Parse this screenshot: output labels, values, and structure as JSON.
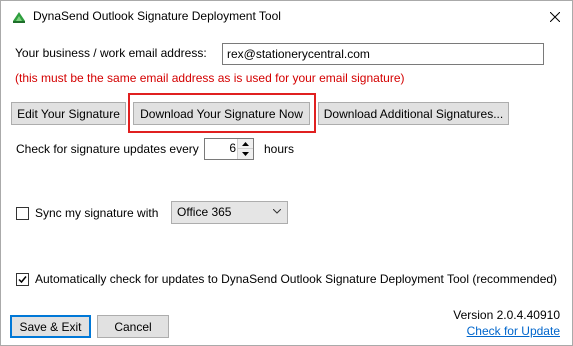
{
  "window": {
    "title": "DynaSend Outlook Signature Deployment Tool",
    "close_label": "✕"
  },
  "email": {
    "label": "Your business / work email address:",
    "value": "rex@stationerycentral.com",
    "warning": "(this must be the same email address as is used for your email signature)"
  },
  "buttons": {
    "edit": "Edit Your Signature",
    "download": "Download Your Signature Now",
    "download_additional": "Download Additional Signatures...",
    "save_exit": "Save & Exit",
    "cancel": "Cancel"
  },
  "updates": {
    "prefix": "Check for signature updates every",
    "value": "6",
    "suffix": "hours"
  },
  "sync": {
    "label": "Sync my signature with",
    "checked": false,
    "selected": "Office 365"
  },
  "auto_check": {
    "label": "Automatically check for updates to DynaSend Outlook Signature Deployment Tool (recommended)",
    "checked": true
  },
  "footer": {
    "version": "Version 2.0.4.40910",
    "check_link": "Check for Update"
  },
  "colors": {
    "warning": "#d40000",
    "highlight": "#e02020",
    "link": "#0066cc",
    "default_border": "#0078d7"
  }
}
